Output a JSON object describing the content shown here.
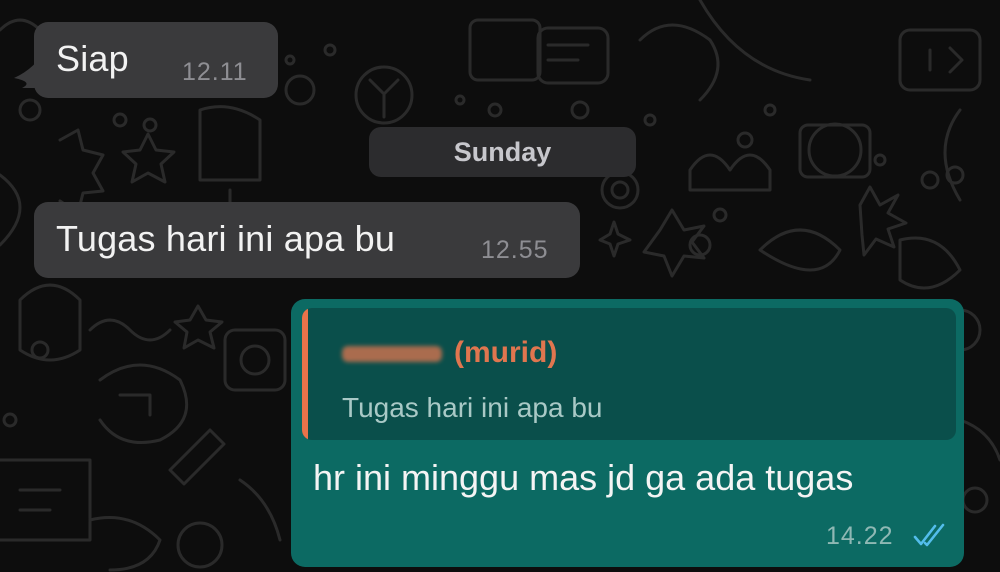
{
  "messages": [
    {
      "direction": "incoming",
      "text": "Siap",
      "time": "12.11"
    },
    {
      "direction": "incoming",
      "text": "Tugas hari ini apa bu",
      "time": "12.55"
    }
  ],
  "date_separator": "Sunday",
  "reply": {
    "quoted_author_suffix": "(murid)",
    "quoted_text": "Tugas hari ini apa bu",
    "text": "hr ini minggu mas jd ga ada tugas",
    "time": "14.22",
    "status_icon": "double-check-read-icon"
  },
  "colors": {
    "background": "#0d0d0d",
    "incoming_bubble": "#3a3a3c",
    "outgoing_bubble": "#0c6a63",
    "quote_background": "#0a4f4b",
    "quote_accent": "#e8734a",
    "read_tick": "#53bdeb"
  }
}
